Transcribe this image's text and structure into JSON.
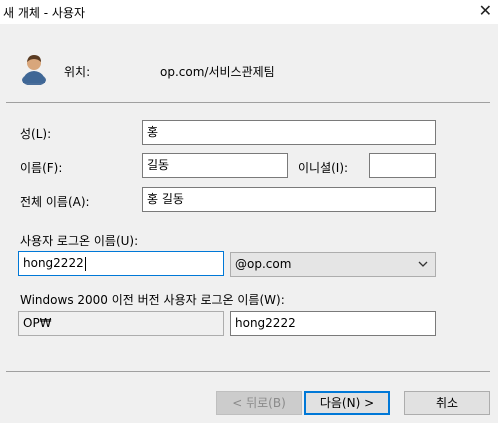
{
  "window": {
    "title": "새 개체 - 사용자",
    "close_glyph": "✕"
  },
  "location": {
    "icon": "user-icon",
    "label": "위치:",
    "value": "op.com/서비스관제팀"
  },
  "form": {
    "last_name": {
      "label": "성(L):",
      "value": "홍"
    },
    "first_name": {
      "label": "이름(F):",
      "value": "길동"
    },
    "initials": {
      "label": "이니셜(I):",
      "value": ""
    },
    "full_name": {
      "label": "전체 이름(A):",
      "value": "홍 길동"
    },
    "logon_name": {
      "label": "사용자 로그온 이름(U):",
      "value": "hong2222"
    },
    "upn_suffix": {
      "selected": "@op.com"
    },
    "pre2000": {
      "label": "Windows 2000 이전 버전 사용자 로그온 이름(W):",
      "domain": "OP₩",
      "value": "hong2222"
    }
  },
  "buttons": {
    "back": "< 뒤로(B)",
    "next": "다음(N) >",
    "cancel": "취소"
  }
}
